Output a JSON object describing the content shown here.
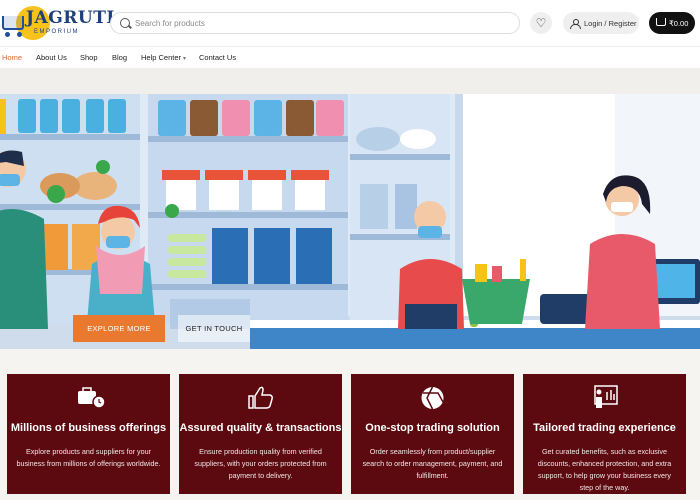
{
  "header": {
    "logo_name": "JAGRUTI",
    "logo_sub": "EMPORIUM",
    "search_placeholder": "Search for products",
    "login_label": "Login / Register",
    "cart_total": "₹0.00"
  },
  "nav": {
    "items": [
      {
        "label": "Home",
        "active": true
      },
      {
        "label": "About Us"
      },
      {
        "label": "Shop"
      },
      {
        "label": "Blog"
      },
      {
        "label": "Help Center"
      },
      {
        "label": "Contact Us"
      }
    ]
  },
  "hero": {
    "primary_button": "EXPLORE MORE",
    "secondary_button": "GET IN TOUCH"
  },
  "features": [
    {
      "icon": "briefcase-clock-icon",
      "title": "Millions of business offerings",
      "desc": "Explore products and suppliers for your business from millions of offerings worldwide."
    },
    {
      "icon": "thumbs-up-icon",
      "title": "Assured quality & transactions",
      "desc": "Ensure production quality from verified suppliers, with your orders protected from payment to delivery."
    },
    {
      "icon": "aperture-icon",
      "title": "One-stop trading solution",
      "desc": "Order seamlessly from product/supplier search to order management, payment, and fulfillment."
    },
    {
      "icon": "presenter-icon",
      "title": "Tailored trading experience",
      "desc": "Get curated benefits, such as exclusive discounts, enhanced protection, and extra support, to help grow your business every step of the way."
    }
  ],
  "colors": {
    "accent": "#e8792e",
    "card_bg": "#5c0a10",
    "nav_active": "#e8672c"
  }
}
